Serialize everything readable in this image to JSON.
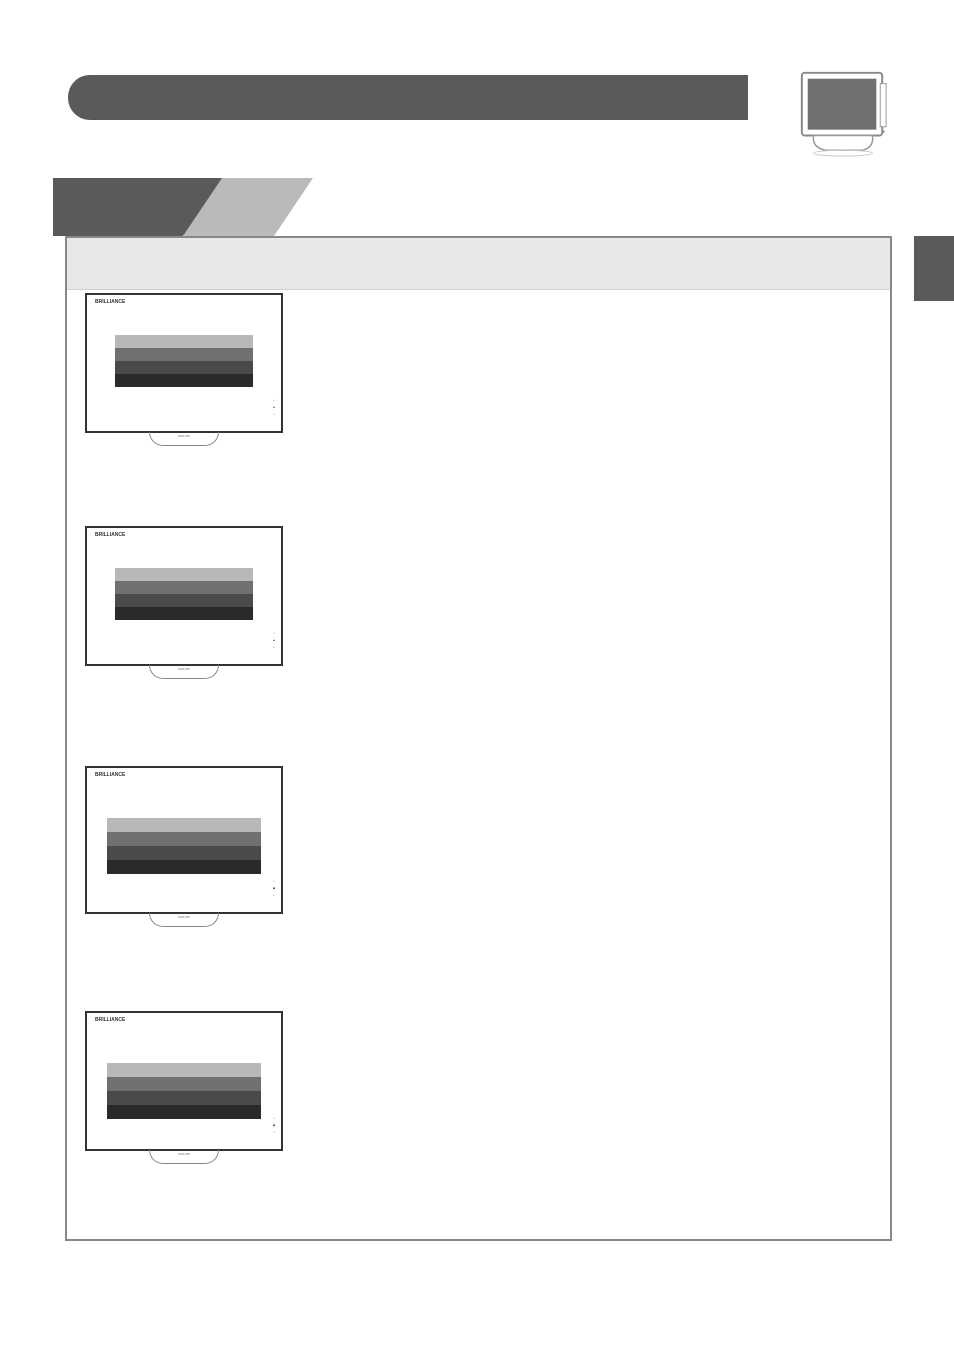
{
  "header": {
    "title": ""
  },
  "tv": {
    "brand_label": "BRILLIANCE",
    "stand_label": "PHILIPS"
  },
  "diagrams": [
    {
      "id": 1,
      "buttons": [
        "•",
        "▲",
        "•"
      ]
    },
    {
      "id": 2,
      "buttons": [
        "•",
        "▲",
        "•"
      ]
    },
    {
      "id": 3,
      "buttons": [
        "•",
        "◆",
        "•"
      ]
    },
    {
      "id": 4,
      "buttons": [
        "•",
        "◆",
        "•"
      ]
    }
  ]
}
